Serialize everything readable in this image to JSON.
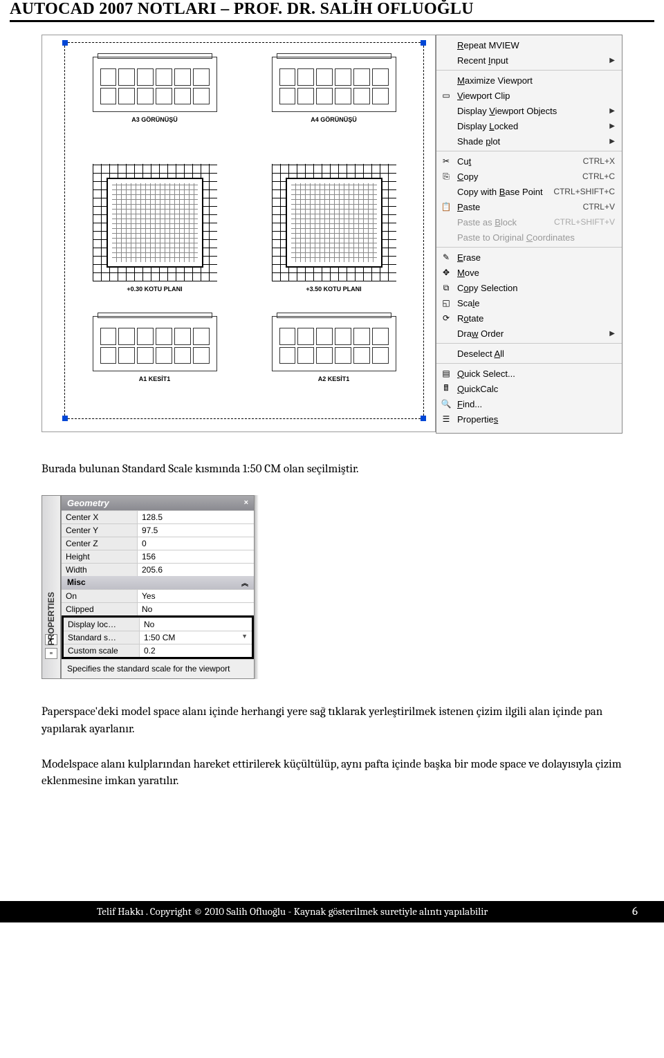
{
  "page_title": "AUTOCAD 2007 NOTLARI – PROF. DR. SALİH OFLUOĞLU",
  "drawing_labels": {
    "elev_a3": "A3 GÖRÜNÜŞÜ",
    "elev_a4": "A4 GÖRÜNÜŞÜ",
    "plan1": "+0.30 KOTU PLANI",
    "plan2": "+3.50 KOTU PLANI",
    "sect_a1": "A1 KESİT1",
    "sect_a2": "A2 KESİT1"
  },
  "ctx_menu": {
    "groups": [
      [
        {
          "label": "Repeat MVIEW",
          "u": 0
        },
        {
          "label": "Recent Input",
          "u": 7,
          "arrow": true
        }
      ],
      [
        {
          "label": "Maximize Viewport",
          "u": 0
        },
        {
          "icon": "vp-clip",
          "label": "Viewport Clip",
          "u": 0
        },
        {
          "label": "Display Viewport Objects",
          "u": 8,
          "arrow": true
        },
        {
          "label": "Display Locked",
          "u": 8,
          "arrow": true
        },
        {
          "label": "Shade plot",
          "u": 6,
          "arrow": true
        }
      ],
      [
        {
          "icon": "cut",
          "label": "Cut",
          "u": 2,
          "short": "CTRL+X"
        },
        {
          "icon": "copy",
          "label": "Copy",
          "u": 0,
          "short": "CTRL+C"
        },
        {
          "label": "Copy with Base Point",
          "u": 10,
          "short": "CTRL+SHIFT+C"
        },
        {
          "icon": "paste",
          "label": "Paste",
          "u": 0,
          "short": "CTRL+V"
        },
        {
          "label": "Paste as Block",
          "u": 9,
          "short": "CTRL+SHIFT+V",
          "disabled": true
        },
        {
          "label": "Paste to Original Coordinates",
          "u": 18,
          "disabled": true
        }
      ],
      [
        {
          "icon": "erase",
          "label": "Erase",
          "u": 0
        },
        {
          "icon": "move",
          "label": "Move",
          "u": 0
        },
        {
          "icon": "copysel",
          "label": "Copy Selection",
          "u": 1
        },
        {
          "icon": "scale",
          "label": "Scale",
          "u": 3
        },
        {
          "icon": "rotate",
          "label": "Rotate",
          "u": 1
        },
        {
          "label": "Draw Order",
          "u": 3,
          "arrow": true
        }
      ],
      [
        {
          "label": "Deselect All",
          "u": 9
        }
      ],
      [
        {
          "icon": "qselect",
          "label": "Quick Select...",
          "u": 0
        },
        {
          "icon": "quickcalc",
          "label": "QuickCalc",
          "u": 0
        },
        {
          "icon": "find",
          "label": "Find...",
          "u": 0
        },
        {
          "icon": "props",
          "label": "Properties",
          "u": 9
        }
      ]
    ]
  },
  "para1": "Burada bulunan Standard Scale kısmında 1:50 CM olan seçilmiştir.",
  "properties": {
    "sidebar_label": "PROPERTIES",
    "geom_title": "Geometry",
    "rows_geom": [
      {
        "k": "Center X",
        "v": "128.5"
      },
      {
        "k": "Center Y",
        "v": "97.5"
      },
      {
        "k": "Center Z",
        "v": "0"
      },
      {
        "k": "Height",
        "v": "156"
      },
      {
        "k": "Width",
        "v": "205.6"
      }
    ],
    "misc_title": "Misc",
    "rows_misc": [
      {
        "k": "On",
        "v": "Yes"
      },
      {
        "k": "Clipped",
        "v": "No"
      }
    ],
    "rows_box": [
      {
        "k": "Display loc…",
        "v": "No"
      },
      {
        "k": "Standard s…",
        "v": "1:50 CM",
        "drop": true
      },
      {
        "k": "Custom scale",
        "v": "0.2"
      }
    ],
    "helper": "Specifies the standard scale for the viewport"
  },
  "para2": "Paperspace'deki model space alanı içinde herhangi yere sağ tıklarak yerleştirilmek istenen çizim ilgili alan içinde pan yapılarak ayarlanır.",
  "para3": "Modelspace alanı kulplarından hareket ettirilerek küçültülüp, aynı pafta içinde başka bir mode space ve dolayısıyla çizim eklenmesine imkan yaratılır.",
  "footer_text": "Telif Hakkı . Copyright © 2010 Salih Ofluoğlu - Kaynak gösterilmek suretiyle alıntı yapılabilir",
  "page_number": "6"
}
